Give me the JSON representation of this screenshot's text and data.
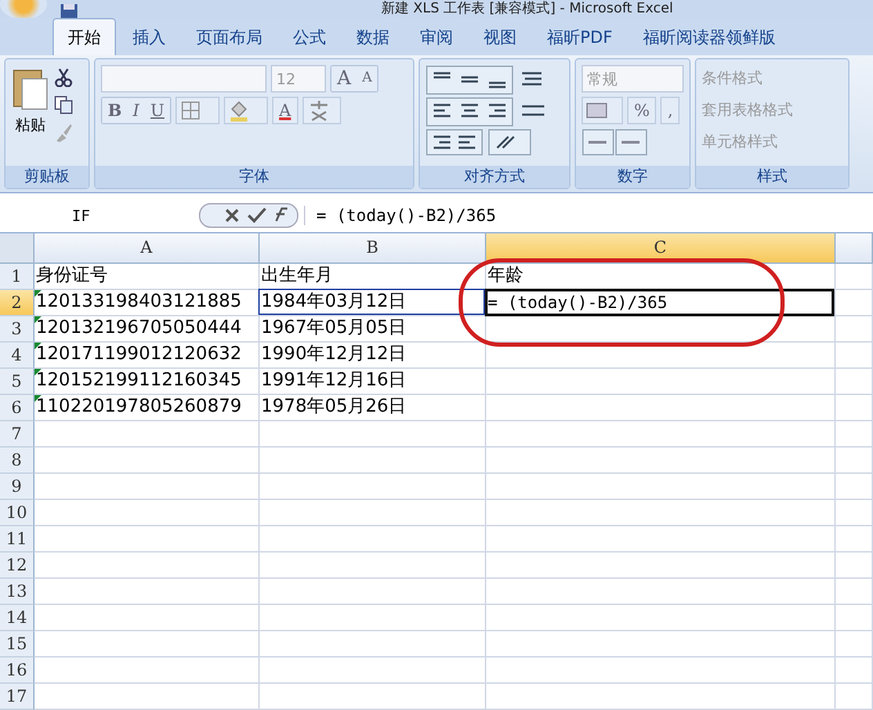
{
  "window": {
    "title": "新建 XLS 工作表 [兼容模式] - Microsoft Excel"
  },
  "tabs": [
    {
      "label": "开始",
      "selected": true
    },
    {
      "label": "插入",
      "selected": false
    },
    {
      "label": "页面布局",
      "selected": false
    },
    {
      "label": "公式",
      "selected": false
    },
    {
      "label": "数据",
      "selected": false
    },
    {
      "label": "审阅",
      "selected": false
    },
    {
      "label": "视图",
      "selected": false
    },
    {
      "label": "福昕PDF",
      "selected": false
    },
    {
      "label": "福昕阅读器领鲜版",
      "selected": false
    }
  ],
  "ribbon": {
    "groups": [
      {
        "kind": "clipboard",
        "label": "剪贴板",
        "paste": "粘贴"
      },
      {
        "kind": "font",
        "label": "字体",
        "font_size": "12",
        "grow": "A",
        "shrink": "A",
        "bold": "B",
        "italic": "I",
        "underline": "U",
        "font_color": "A"
      },
      {
        "kind": "alignment",
        "label": "对齐方式"
      },
      {
        "kind": "number",
        "label": "数字",
        "format": "常规",
        "percent": "%",
        "comma": ","
      },
      {
        "kind": "styles",
        "label": "样式",
        "items": [
          "条件格式",
          "套用表格格式",
          "单元格样式"
        ]
      }
    ]
  },
  "formula_bar": {
    "name_box": "IF",
    "formula": "= (today()-B2)/365"
  },
  "columns": [
    {
      "label": "A",
      "selected": false
    },
    {
      "label": "B",
      "selected": false
    },
    {
      "label": "C",
      "selected": true
    }
  ],
  "rows": [
    {
      "number": "1",
      "selected": false,
      "cells": [
        {
          "text": "身份证号"
        },
        {
          "text": "出生年月"
        },
        {
          "text": "年龄"
        }
      ]
    },
    {
      "number": "2",
      "selected": true,
      "cells": [
        {
          "text": "120133198403121885",
          "number_as_text": true
        },
        {
          "text": "1984年03月12日",
          "referenced": true
        },
        {
          "text": "= (today()-B2)/365",
          "selected": true,
          "circled": true
        }
      ]
    },
    {
      "number": "3",
      "selected": false,
      "cells": [
        {
          "text": "120132196705050444",
          "number_as_text": true
        },
        {
          "text": "1967年05月05日"
        }
      ]
    },
    {
      "number": "4",
      "selected": false,
      "cells": [
        {
          "text": "120171199012120632",
          "number_as_text": true
        },
        {
          "text": "1990年12月12日"
        }
      ]
    },
    {
      "number": "5",
      "selected": false,
      "cells": [
        {
          "text": "120152199112160345",
          "number_as_text": true
        },
        {
          "text": "1991年12月16日"
        }
      ]
    },
    {
      "number": "6",
      "selected": false,
      "cells": [
        {
          "text": "110220197805260879",
          "number_as_text": true
        },
        {
          "text": "1978年05月26日"
        }
      ]
    },
    {
      "number": "7",
      "selected": false
    },
    {
      "number": "8",
      "selected": false
    },
    {
      "number": "9",
      "selected": false
    },
    {
      "number": "10",
      "selected": false
    },
    {
      "number": "11",
      "selected": false
    },
    {
      "number": "12",
      "selected": false
    },
    {
      "number": "13",
      "selected": false
    },
    {
      "number": "14",
      "selected": false
    },
    {
      "number": "15",
      "selected": false
    },
    {
      "number": "16",
      "selected": false
    },
    {
      "number": "17",
      "selected": false
    }
  ]
}
